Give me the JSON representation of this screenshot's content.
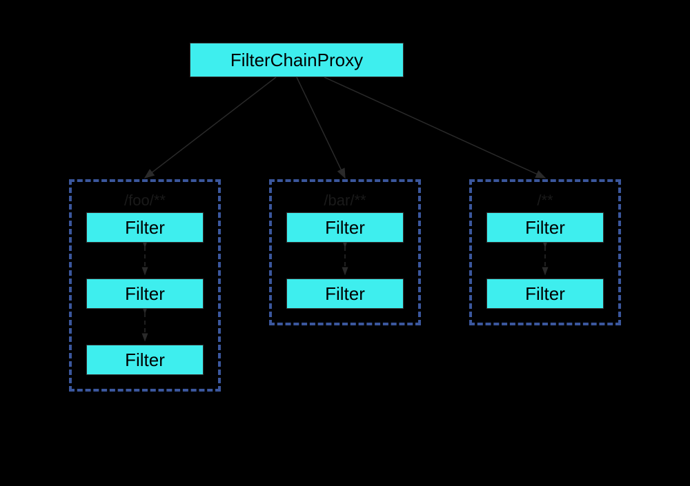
{
  "proxy": {
    "label": "FilterChainProxy"
  },
  "chains": [
    {
      "pattern": "/foo/**",
      "filters": [
        "Filter",
        "Filter",
        "Filter"
      ]
    },
    {
      "pattern": "/bar/**",
      "filters": [
        "Filter",
        "Filter"
      ]
    },
    {
      "pattern": "/**",
      "filters": [
        "Filter",
        "Filter"
      ]
    }
  ],
  "colors": {
    "node_fill": "#3eeeee",
    "group_border": "#3b579d",
    "background": "#000000"
  }
}
